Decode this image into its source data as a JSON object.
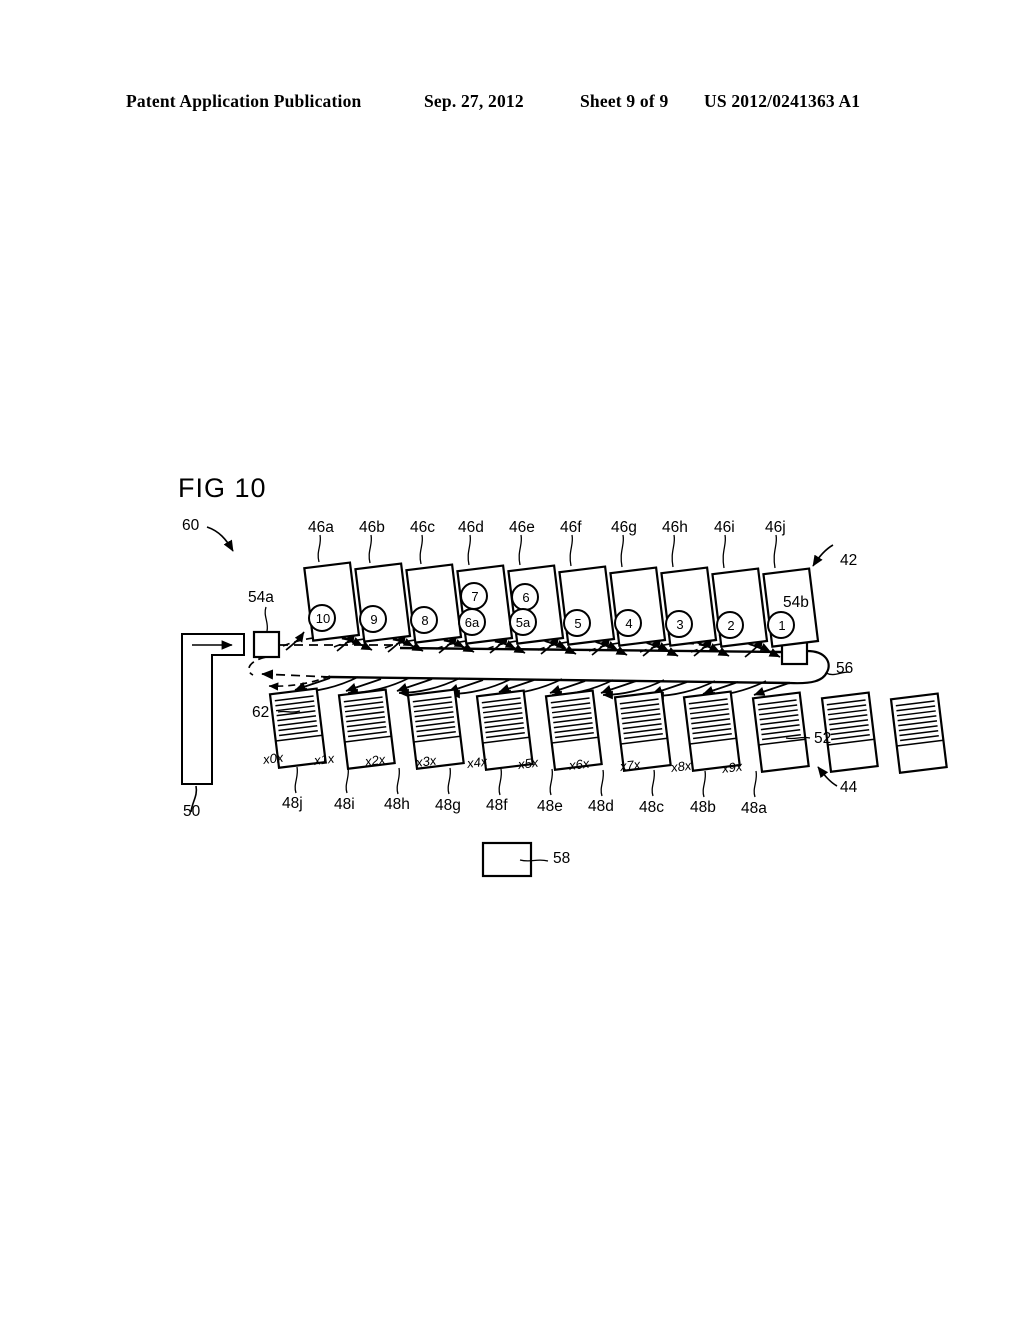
{
  "header": {
    "publication": "Patent Application Publication",
    "date": "Sep. 27, 2012",
    "sheet": "Sheet 9 of 9",
    "number": "US 2012/0241363 A1"
  },
  "figure": {
    "title": "FIG  10",
    "system_ref": "60",
    "upper_section_ref": "42",
    "lower_section_ref": "44",
    "source_unit_ref": "50",
    "left_node_ref": "54a",
    "right_node_ref": "54b",
    "return_path_ref": "56",
    "collector_ref": "58",
    "lower_item_ref": "52",
    "lower_detail_ref": "62",
    "upper_items": [
      {
        "ref": "46a",
        "numbers": [
          "10"
        ]
      },
      {
        "ref": "46b",
        "numbers": [
          "9"
        ]
      },
      {
        "ref": "46c",
        "numbers": [
          "8"
        ]
      },
      {
        "ref": "46d",
        "numbers": [
          "7",
          "6a"
        ]
      },
      {
        "ref": "46e",
        "numbers": [
          "6",
          "5a"
        ]
      },
      {
        "ref": "46f",
        "numbers": [
          "5"
        ]
      },
      {
        "ref": "46g",
        "numbers": [
          "4"
        ]
      },
      {
        "ref": "46h",
        "numbers": [
          "3"
        ]
      },
      {
        "ref": "46i",
        "numbers": [
          "2"
        ]
      },
      {
        "ref": "46j",
        "numbers": [
          "1"
        ]
      }
    ],
    "lower_items": [
      {
        "ref": "48j",
        "code": "x0x"
      },
      {
        "ref": "48i",
        "code": "x1x"
      },
      {
        "ref": "48h",
        "code": "x2x"
      },
      {
        "ref": "48g",
        "code": "x3x"
      },
      {
        "ref": "48f",
        "code": "x4x"
      },
      {
        "ref": "48e",
        "code": "x5x"
      },
      {
        "ref": "48d",
        "code": "x6x"
      },
      {
        "ref": "48c",
        "code": "x7x"
      },
      {
        "ref": "48b",
        "code": "x8x"
      },
      {
        "ref": "48a",
        "code": "x9x"
      }
    ]
  },
  "colors": {
    "ink": "#000000",
    "paper": "#ffffff"
  }
}
